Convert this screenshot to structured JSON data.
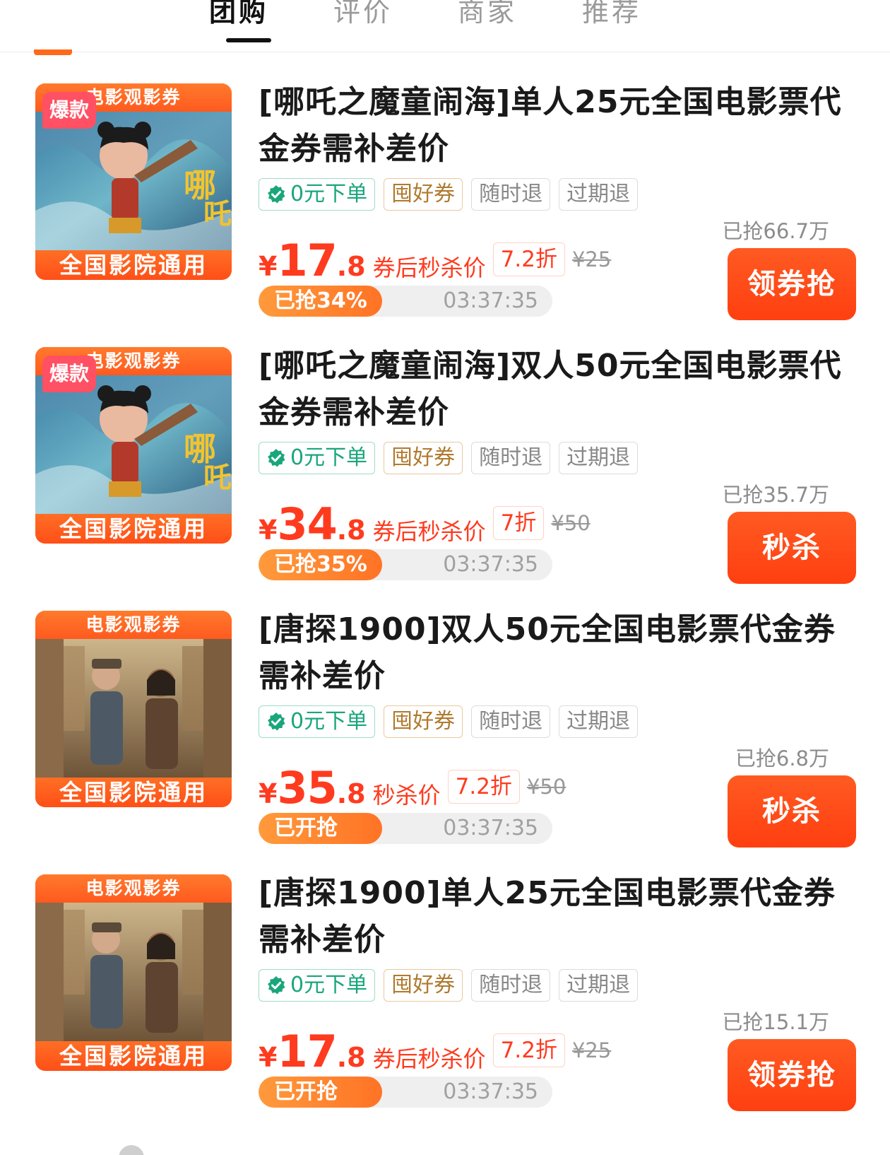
{
  "tabs": [
    {
      "label": "团购",
      "active": true
    },
    {
      "label": "评价",
      "active": false
    },
    {
      "label": "商家",
      "active": false
    },
    {
      "label": "推荐",
      "active": false
    }
  ],
  "colors": {
    "accent": "#ff3b1f",
    "button": "#ff4a16",
    "tag_green": "#1aa67b",
    "tag_brown": "#b07a2e"
  },
  "deals": [
    {
      "thumb_top": "电影观影券",
      "thumb_bottom": "全国影院通用",
      "hot_badge": "爆款",
      "poster": "nezha",
      "title": "[哪吒之魔童闹海]单人25元全国电影票代金券需补差价",
      "tags": [
        "0元下单",
        "囤好券",
        "随时退",
        "过期退"
      ],
      "sold": "已抢66.7万",
      "yen": "¥",
      "price_int": "17",
      "price_dec": ".8",
      "price_label": "券后秒杀价",
      "discount": "7.2折",
      "original": "¥25",
      "progress_text": "已抢34%",
      "progress_value": 0.42,
      "countdown": "03:37:35",
      "button": "领券抢"
    },
    {
      "thumb_top": "电影观影券",
      "thumb_bottom": "全国影院通用",
      "hot_badge": "爆款",
      "poster": "nezha",
      "title": "[哪吒之魔童闹海]双人50元全国电影票代金券需补差价",
      "tags": [
        "0元下单",
        "囤好券",
        "随时退",
        "过期退"
      ],
      "sold": "已抢35.7万",
      "yen": "¥",
      "price_int": "34",
      "price_dec": ".8",
      "price_label": "券后秒杀价",
      "discount": "7折",
      "original": "¥50",
      "progress_text": "已抢35%",
      "progress_value": 0.42,
      "countdown": "03:37:35",
      "button": "秒杀"
    },
    {
      "thumb_top": "电影观影券",
      "thumb_bottom": "全国影院通用",
      "hot_badge": "",
      "poster": "tangtan",
      "title": "[唐探1900]双人50元全国电影票代金券需补差价",
      "tags": [
        "0元下单",
        "囤好券",
        "随时退",
        "过期退"
      ],
      "sold": "已抢6.8万",
      "yen": "¥",
      "price_int": "35",
      "price_dec": ".8",
      "price_label": "秒杀价",
      "discount": "7.2折",
      "original": "¥50",
      "progress_text": "已开抢",
      "progress_value": 0.42,
      "countdown": "03:37:35",
      "button": "秒杀"
    },
    {
      "thumb_top": "电影观影券",
      "thumb_bottom": "全国影院通用",
      "hot_badge": "",
      "poster": "tangtan",
      "title": "[唐探1900]单人25元全国电影票代金券需补差价",
      "tags": [
        "0元下单",
        "囤好券",
        "随时退",
        "过期退"
      ],
      "sold": "已抢15.1万",
      "yen": "¥",
      "price_int": "17",
      "price_dec": ".8",
      "price_label": "券后秒杀价",
      "discount": "7.2折",
      "original": "¥25",
      "progress_text": "已开抢",
      "progress_value": 0.42,
      "countdown": "03:37:35",
      "button": "领券抢"
    }
  ]
}
